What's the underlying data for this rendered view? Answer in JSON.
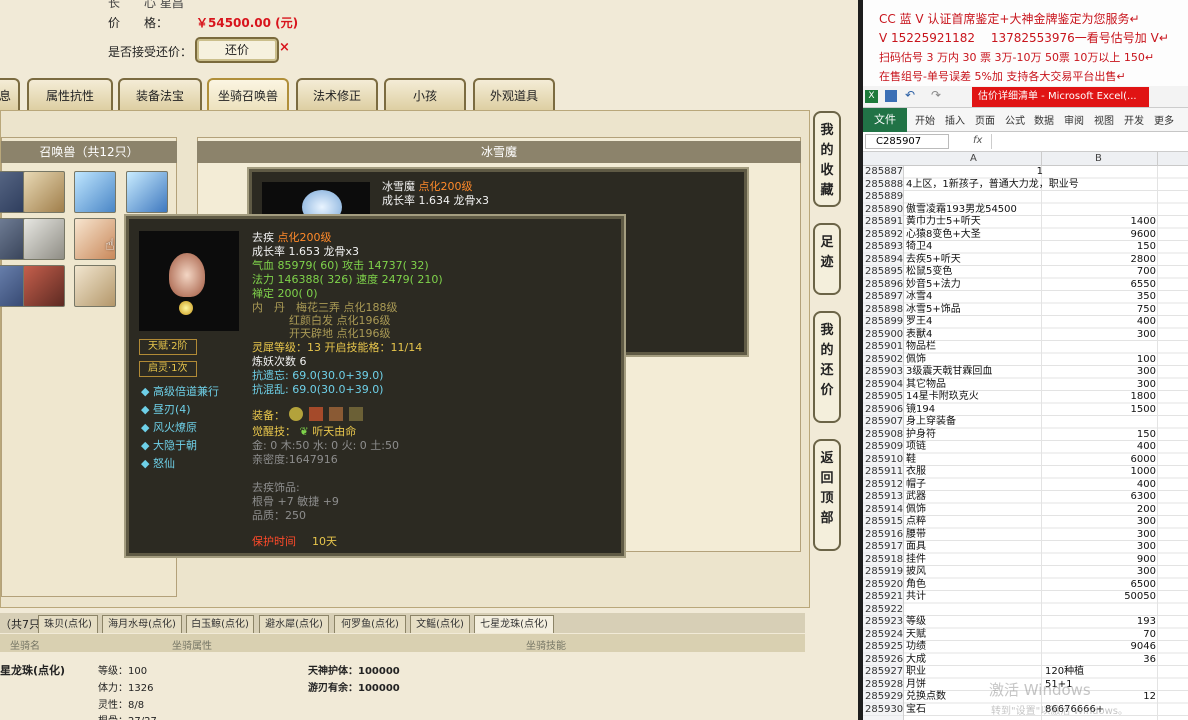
{
  "trade": {
    "price_label": "价　　格：",
    "price_value": "￥54500.00 (元)",
    "haggle_label": "是否接受还价：",
    "haggle_button": "还价"
  },
  "tabs": [
    {
      "label": "息"
    },
    {
      "label": "属性抗性"
    },
    {
      "label": "装备法宝"
    },
    {
      "label": "坐骑召唤兽"
    },
    {
      "label": "法术修正"
    },
    {
      "label": "小孩"
    },
    {
      "label": "外观道具"
    }
  ],
  "pets_panel": {
    "header": "召唤兽（共12只）"
  },
  "detail_panel": {
    "header": "冰雪魔",
    "pet_name": "冰雪魔",
    "pet_badge": "点化200级",
    "growth": "成长率 1.634 龙骨x3"
  },
  "tooltip": {
    "name": "去疾",
    "badge": "点化200级",
    "growth": "成长率 1.653 龙骨x3",
    "hp_label": "气血",
    "hp_value": "85979( 60)",
    "atk_label": "攻击",
    "atk_value": "14737( 32)",
    "mp_label": "法力",
    "mp_value": "146388( 326)",
    "spd_label": "速度",
    "spd_value": "2479( 210)",
    "zen_label": "禅定",
    "zen_value": "200( 0)",
    "neidan_label": "内　丹",
    "neidan_1": "梅花三弄 点化188级",
    "neidan_2": "红颜白发 点化196级",
    "neidan_3": "开天辟地 点化196级",
    "lingxi": "灵犀等级：13 开启技能格：11/14",
    "lianyao": "炼妖次数 6",
    "kangyiwang": "抗遗忘: 69.0(30.0+39.0)",
    "kanghunluan": "抗混乱: 69.0(30.0+39.0)",
    "tianfu": "天赋·2阶",
    "qiling": "启灵·1次",
    "skills": [
      "高级倍道兼行",
      "昼刃(4)",
      "风火燎原",
      "大隐于朝",
      "怒仙"
    ],
    "equip_label": "装备：",
    "awaken_label": "觉醒技：",
    "awaken_value": "听天由命",
    "elements": "金: 0 木:50 水: 0 火: 0 土:50",
    "intimacy": "亲密度:1647916",
    "ornament_title": "去疾饰品:",
    "ornament_attrs": "根骨 +7 敏捷 +9",
    "ornament_quality": "品质：250",
    "protect_label": "保护时间",
    "protect_value": "10天"
  },
  "side_buttons": [
    "我的收藏",
    "足迹",
    "我的还价",
    "返回顶部"
  ],
  "mounts": {
    "count_label": "（共7只",
    "tabs": [
      "珠贝(点化)",
      "海月水母(点化)",
      "白玉鲸(点化)",
      "避水犀(点化)",
      "何罗鱼(点化)",
      "文鳐(点化)",
      "七星龙珠(点化)"
    ],
    "col_name": "坐骑名",
    "col_attr": "坐骑属性",
    "col_skill": "坐骑技能",
    "name": "星龙珠(点化)",
    "attrs": [
      "等级：100",
      "体力：1326",
      "灵性：8/8",
      "根骨：27/27"
    ],
    "skills": [
      "天神护体：100000",
      "游刃有余：100000"
    ]
  },
  "notes": [
    "CC 蓝 V 认证首席鉴定+大神金牌鉴定为您服务↵",
    "V 15225921182　 13782553976一看号估号加 V↵",
    "扫码估号 3 万内 30 票 3万-10万 50票 10万以上 150↵",
    "在售组号-单号误差 5%加 支持各大交易平台出售↵"
  ],
  "excel": {
    "title": "估价详细清单 - Microsoft Excel(...",
    "tabs": [
      "文件",
      "开始",
      "插入",
      "页面",
      "公式",
      "数据",
      "审阅",
      "视图",
      "开发",
      "更多"
    ],
    "name_box": "C285907",
    "fx": "fx",
    "col_a": "A",
    "col_b": "B",
    "rows": [
      {
        "n": "285887",
        "a": "",
        "b": "1",
        "bc": true
      },
      {
        "n": "285888",
        "a": "4上区，1新孩子，普通大力龙，职业号",
        "b": ""
      },
      {
        "n": "285889",
        "a": "",
        "b": ""
      },
      {
        "n": "285890",
        "a": "傲雪凌霜193男龙54500",
        "b": ""
      },
      {
        "n": "285891",
        "a": "黄巾力士5+听天",
        "b": "1400"
      },
      {
        "n": "285892",
        "a": "心猿8变色+大圣",
        "b": "9600"
      },
      {
        "n": "285893",
        "a": "犄卫4",
        "b": "150"
      },
      {
        "n": "285894",
        "a": "去疾5+听天",
        "b": "2800"
      },
      {
        "n": "285895",
        "a": "松鼠5变色",
        "b": "700"
      },
      {
        "n": "285896",
        "a": "妙音5+法力",
        "b": "6550"
      },
      {
        "n": "285897",
        "a": "冰雪4",
        "b": "350"
      },
      {
        "n": "285898",
        "a": "冰雪5+饰品",
        "b": "750"
      },
      {
        "n": "285899",
        "a": "罗王4",
        "b": "400"
      },
      {
        "n": "285900",
        "a": "表獸4",
        "b": "300"
      },
      {
        "n": "285901",
        "a": "物品栏",
        "b": ""
      },
      {
        "n": "285902",
        "a": "佩饰",
        "b": "100"
      },
      {
        "n": "285903",
        "a": "3级震天戟甘霖回血",
        "b": "300"
      },
      {
        "n": "285904",
        "a": "其它物品",
        "b": "300"
      },
      {
        "n": "285905",
        "a": "14星卡附玖克火",
        "b": "1800"
      },
      {
        "n": "285906",
        "a": "镜194",
        "b": "1500"
      },
      {
        "n": "285907",
        "a": "身上穿装备",
        "b": ""
      },
      {
        "n": "285908",
        "a": "护身符",
        "b": "150"
      },
      {
        "n": "285909",
        "a": "项链",
        "b": "400"
      },
      {
        "n": "285910",
        "a": "鞋",
        "b": "6000"
      },
      {
        "n": "285911",
        "a": "衣服",
        "b": "1000"
      },
      {
        "n": "285912",
        "a": "帽子",
        "b": "400"
      },
      {
        "n": "285913",
        "a": "武器",
        "b": "6300"
      },
      {
        "n": "285914",
        "a": "佩饰",
        "b": "200"
      },
      {
        "n": "285915",
        "a": "点粹",
        "b": "300"
      },
      {
        "n": "285916",
        "a": "腰带",
        "b": "300"
      },
      {
        "n": "285917",
        "a": "面具",
        "b": "300"
      },
      {
        "n": "285918",
        "a": "挂件",
        "b": "900"
      },
      {
        "n": "285919",
        "a": "披风",
        "b": "300"
      },
      {
        "n": "285920",
        "a": "角色",
        "b": "6500"
      },
      {
        "n": "285921",
        "a": "共计",
        "b": "50050"
      },
      {
        "n": "285922",
        "a": "",
        "b": ""
      },
      {
        "n": "285923",
        "a": "等级",
        "b": "193"
      },
      {
        "n": "285924",
        "a": "天赋",
        "b": "70"
      },
      {
        "n": "285925",
        "a": "功绩",
        "b": "9046"
      },
      {
        "n": "285926",
        "a": "大成",
        "b": "36"
      },
      {
        "n": "285927",
        "a": "职业",
        "b": "120种植",
        "bl": true
      },
      {
        "n": "285928",
        "a": "月饼",
        "b": "51+1",
        "bl": true
      },
      {
        "n": "285929",
        "a": "兑换点数",
        "b": "12"
      },
      {
        "n": "285930",
        "a": "宝石",
        "b": "86676666+",
        "bl": true
      }
    ],
    "watermark_1": "激活 Windows",
    "watermark_2": "转到\"设置\"以激活 Windows。"
  }
}
